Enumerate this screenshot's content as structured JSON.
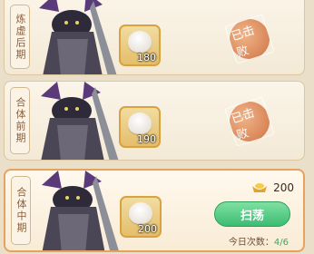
{
  "stages": [
    {
      "name": "炼虚后期",
      "reward": {
        "item": "bun",
        "count": "180"
      },
      "status": "已击败"
    },
    {
      "name": "合体前期",
      "reward": {
        "item": "bun",
        "count": "190"
      },
      "status": "已击败"
    },
    {
      "name": "合体中期",
      "reward": {
        "item": "bun",
        "count": "200"
      },
      "cost": "200",
      "sweep_label": "扫荡",
      "tries_label": "今日次数：",
      "tries_value": "4/6"
    }
  ],
  "colors": {
    "accent": "#3cbc73",
    "seal": "#d9875a",
    "border": "#e7a35e"
  }
}
